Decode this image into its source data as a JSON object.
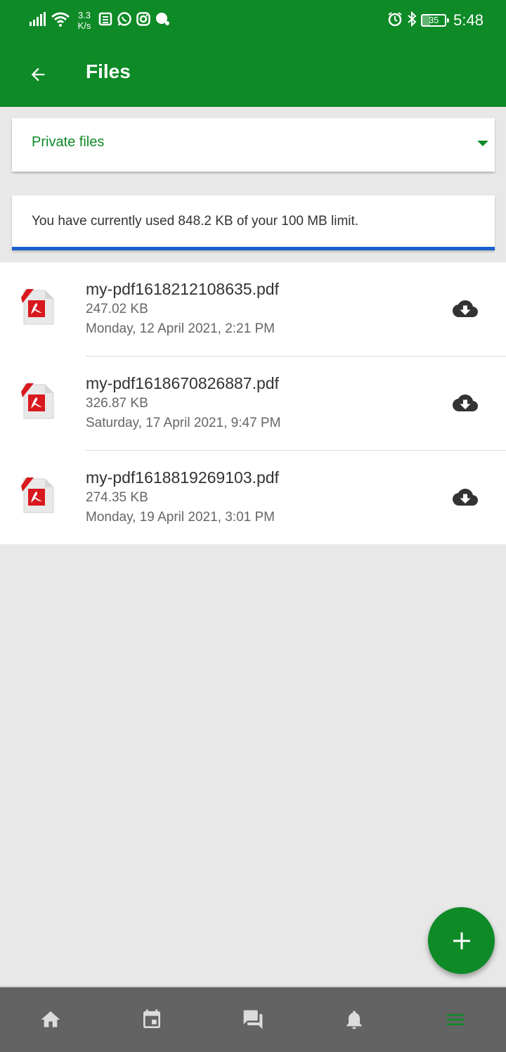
{
  "status_bar": {
    "net_speed_value": "3.3",
    "net_speed_unit": "K/s",
    "battery": "35",
    "time": "5:48",
    "icons": [
      "signal-icon",
      "wifi-icon",
      "news-icon",
      "whatsapp-icon",
      "instagram-icon",
      "chat-icon",
      "alarm-icon",
      "bluetooth-icon",
      "battery-icon"
    ]
  },
  "app_bar": {
    "title": "Files"
  },
  "folder_select": {
    "selected": "Private files"
  },
  "usage": {
    "text": "You have currently used 848.2 KB of your 100 MB limit.",
    "used_fraction": 0.008
  },
  "files": [
    {
      "name": "my-pdf1618212108635.pdf",
      "size": "247.02 KB",
      "date": "Monday, 12 April 2021, 2:21 PM"
    },
    {
      "name": "my-pdf1618670826887.pdf",
      "size": "326.87 KB",
      "date": "Saturday, 17 April 2021, 9:47 PM"
    },
    {
      "name": "my-pdf1618819269103.pdf",
      "size": "274.35 KB",
      "date": "Monday, 19 April 2021, 3:01 PM"
    }
  ],
  "bottom_nav": {
    "items": [
      "home-icon",
      "calendar-icon",
      "messages-icon",
      "notifications-icon",
      "menu-icon"
    ],
    "active": "menu-icon"
  },
  "colors": {
    "primary": "#0e8a27",
    "progress": "#1a5fcc",
    "nav_background": "#636363"
  }
}
